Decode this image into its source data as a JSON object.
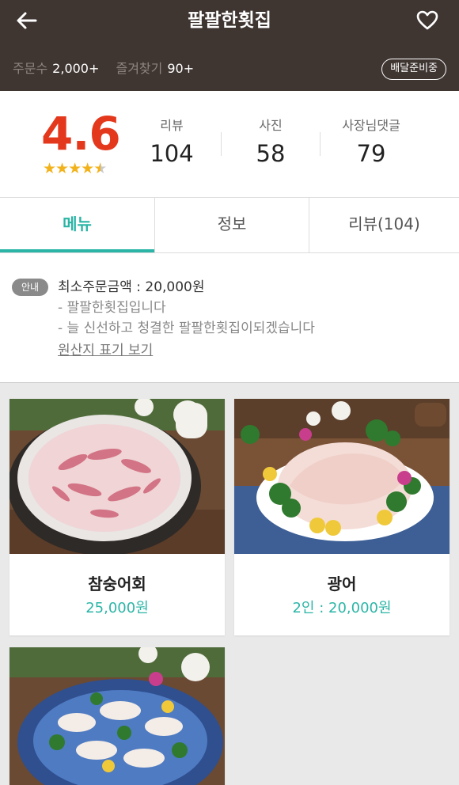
{
  "header": {
    "title": "팔팔한횟집",
    "back_icon": "arrow-left-icon",
    "favorite_icon": "heart-outline-icon",
    "order_count_label": "주문수",
    "order_count_value": "2,000+",
    "favorites_label": "즐겨찾기",
    "favorites_value": "90+",
    "status_badge": "배달준비중"
  },
  "summary": {
    "rating": "4.6",
    "stars_value": 4.6,
    "reviews_label": "리뷰",
    "reviews_value": "104",
    "photos_label": "사진",
    "photos_value": "58",
    "owner_comments_label": "사장님댓글",
    "owner_comments_value": "79"
  },
  "tabs": [
    {
      "label": "메뉴",
      "active": true
    },
    {
      "label": "정보",
      "active": false
    },
    {
      "label": "리뷰(104)",
      "active": false
    }
  ],
  "notice": {
    "badge": "안내",
    "line1": "최소주문금액 : 20,000원",
    "line2": "- 팔팔한횟집입니다",
    "line3": "- 늘 신선하고 청결한 팔팔한횟집이되겠습니다",
    "origin_link": "원산지 표기 보기"
  },
  "menu_items": [
    {
      "name": "참숭어회",
      "price": "25,000원"
    },
    {
      "name": "광어",
      "price": "2인 : 20,000원"
    },
    {
      "name": "",
      "price": ""
    }
  ],
  "colors": {
    "header_bg": "#3f3632",
    "accent": "#2bb5a6",
    "rating": "#e4381c",
    "star": "#f2b21b"
  }
}
